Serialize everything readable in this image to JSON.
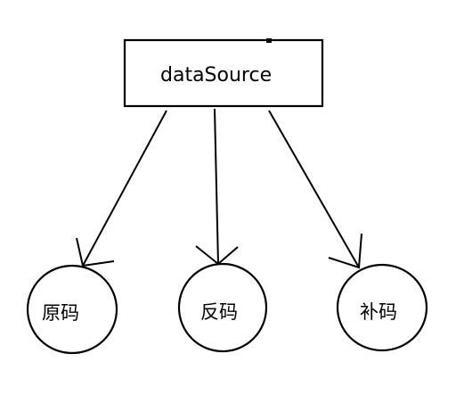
{
  "diagram": {
    "root": {
      "label": "dataSource"
    },
    "children": [
      {
        "label": "原码"
      },
      {
        "label": "反码"
      },
      {
        "label": "补码"
      }
    ]
  }
}
